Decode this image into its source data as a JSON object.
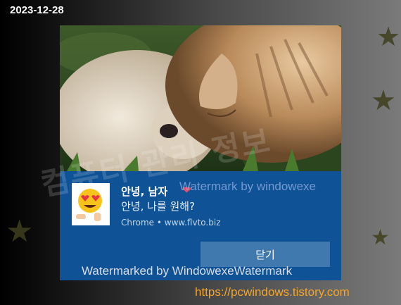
{
  "date_stamp": "2023-12-28",
  "notification": {
    "title": "안녕, 남자",
    "title_heart": "❤",
    "message": "안녕, 나를 원해?",
    "source": "Chrome • www.flvto.biz",
    "close_label": "닫기",
    "avatar_icon": "heart-eyes-emoji-icon",
    "accent_color": "#0f5396"
  },
  "watermarks": {
    "inline": "Watermark by windowexe",
    "bottom": "Watermarked by WindowexeWatermark",
    "diagonal": "컴퓨터 관리 정보"
  },
  "site_url": "https://pcwindows.tistory.com"
}
